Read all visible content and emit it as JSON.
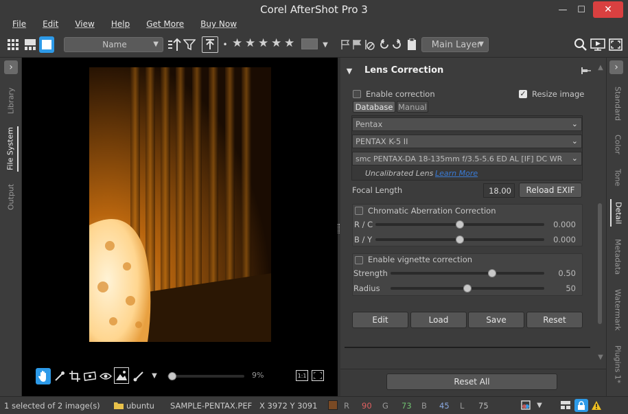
{
  "window": {
    "title": "Corel AfterShot Pro 3",
    "min": "—",
    "max": "☐",
    "close": "✕"
  },
  "menu": [
    "File",
    "Edit",
    "View",
    "Help",
    "Get More",
    "Buy Now"
  ],
  "toolbar": {
    "sort_value": "Name",
    "layer_value": "Main Layer",
    "stars": [
      "★",
      "★",
      "★",
      "★",
      "★"
    ],
    "dot": "•"
  },
  "left_tabs": [
    "Library",
    "File System",
    "Output"
  ],
  "right_tabs": [
    "Standard",
    "Color",
    "Tone",
    "Detail",
    "Metadata",
    "Watermark",
    "Plugins 1*"
  ],
  "viewer": {
    "zoom": "9%",
    "one_to_one": "1:1"
  },
  "panel": {
    "title": "Lens Correction",
    "enable_correction": "Enable correction",
    "resize_image": "Resize image",
    "tabs": [
      "Database",
      "Manual"
    ],
    "make": "Pentax",
    "model": "PENTAX K-5 II",
    "lens": "smc PENTAX-DA 18-135mm f/3.5-5.6 ED AL [IF] DC WR",
    "uncalibrated": "Uncalibrated Lens",
    "learn_more": "Learn More",
    "focal_label": "Focal Length",
    "focal_value": "18.00",
    "reload_exif": "Reload EXIF",
    "ca_title": "Chromatic Aberration Correction",
    "rc_label": "R / C",
    "rc_value": "0.000",
    "rc_level": 0.5,
    "by_label": "B / Y",
    "by_value": "0.000",
    "by_level": 0.5,
    "vig_title": "Enable vignette correction",
    "strength_label": "Strength",
    "strength_value": "0.50",
    "strength_level": 0.66,
    "radius_label": "Radius",
    "radius_value": "50",
    "radius_level": 0.5,
    "buttons": [
      "Edit",
      "Load",
      "Save",
      "Reset"
    ],
    "reset_all": "Reset All"
  },
  "status": {
    "selection": "1 selected of 2 image(s)",
    "folder": "ubuntu",
    "file": "SAMPLE-PENTAX.PEF",
    "coords": "X 3972  Y 3091",
    "r_label": "R",
    "r": "90",
    "g_label": "G",
    "g": "73",
    "b_label": "B",
    "b": "45",
    "l_label": "L",
    "l": "75",
    "swatch": "#7a4a24"
  },
  "colors": {
    "accent": "#2d9ae8",
    "link": "#3a7bd5"
  }
}
